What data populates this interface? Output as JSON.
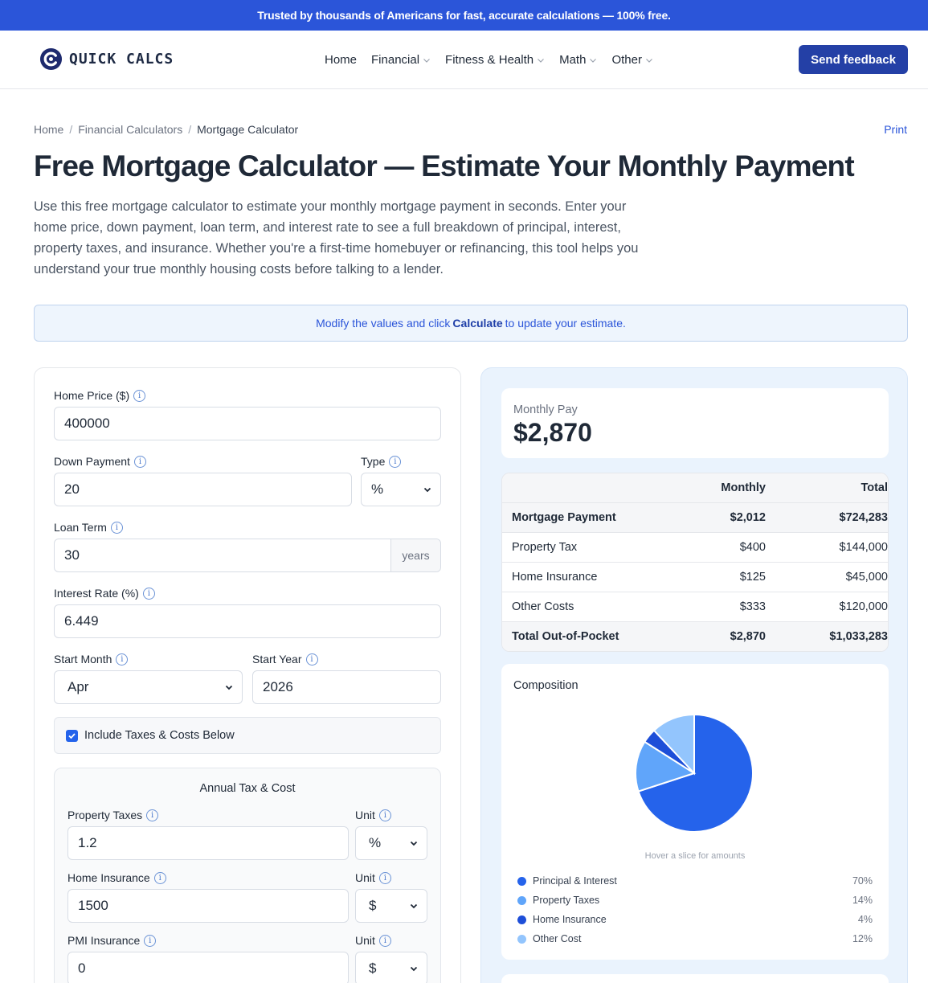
{
  "banner": "Trusted by thousands of Americans for fast, accurate calculations — 100% free.",
  "brand": {
    "name": "QUICK CALCS",
    "color": "#2b55d9"
  },
  "nav": {
    "items": [
      {
        "label": "Home",
        "dropdown": false
      },
      {
        "label": "Financial",
        "dropdown": true
      },
      {
        "label": "Fitness & Health",
        "dropdown": true
      },
      {
        "label": "Math",
        "dropdown": true
      },
      {
        "label": "Other",
        "dropdown": true
      }
    ],
    "feedback": "Send feedback"
  },
  "breadcrumb": [
    "Home",
    "Financial Calculators",
    "Mortgage Calculator"
  ],
  "print": "Print",
  "title": "Free Mortgage Calculator — Estimate Your Monthly Payment",
  "intro": "Use this free mortgage calculator to estimate your monthly mortgage payment in seconds. Enter your home price, down payment, loan term, and interest rate to see a full breakdown of principal, interest, property taxes, and insurance. Whether you're a first-time homebuyer or refinancing, this tool helps you understand your true monthly housing costs before talking to a lender.",
  "notice": {
    "before": "Modify the values and click",
    "bold": "Calculate",
    "after": "to update your estimate."
  },
  "form": {
    "home_price": {
      "label": "Home Price ($)",
      "value": "400000"
    },
    "down_payment": {
      "label": "Down Payment",
      "value": "20"
    },
    "type": {
      "label": "Type",
      "value": "%"
    },
    "loan_term": {
      "label": "Loan Term",
      "value": "30",
      "addon": "years"
    },
    "interest_rate": {
      "label": "Interest Rate (%)",
      "value": "6.449"
    },
    "start_month": {
      "label": "Start Month",
      "value": "Apr"
    },
    "start_year": {
      "label": "Start Year",
      "value": "2026"
    },
    "include_taxes": {
      "label": "Include Taxes & Costs Below",
      "checked": true
    },
    "annual": {
      "title": "Annual Tax & Cost",
      "property_taxes": {
        "label": "Property Taxes",
        "value": "1.2",
        "unit_label": "Unit",
        "unit": "%"
      },
      "home_insurance": {
        "label": "Home Insurance",
        "value": "1500",
        "unit_label": "Unit",
        "unit": "$"
      },
      "pmi_insurance": {
        "label": "PMI Insurance",
        "value": "0",
        "unit_label": "Unit",
        "unit": "$"
      }
    }
  },
  "results": {
    "monthly_label": "Monthly Pay",
    "monthly_value": "$2,870",
    "table": {
      "headers": [
        "",
        "Monthly",
        "Total"
      ],
      "rows": [
        [
          "Mortgage Payment",
          "$2,012",
          "$724,283"
        ],
        [
          "Property Tax",
          "$400",
          "$144,000"
        ],
        [
          "Home Insurance",
          "$125",
          "$45,000"
        ],
        [
          "Other Costs",
          "$333",
          "$120,000"
        ],
        [
          "Total Out-of-Pocket",
          "$2,870",
          "$1,033,283"
        ]
      ]
    },
    "composition": {
      "title": "Composition",
      "hint": "Hover a slice for amounts",
      "legend": [
        {
          "name": "Principal & Interest",
          "pct": "70%",
          "color": "#2563eb"
        },
        {
          "name": "Property Taxes",
          "pct": "14%",
          "color": "#60a5fa"
        },
        {
          "name": "Home Insurance",
          "pct": "4%",
          "color": "#1d4ed8"
        },
        {
          "name": "Other Cost",
          "pct": "12%",
          "color": "#93c5fd"
        }
      ]
    }
  },
  "chart_data": {
    "type": "pie",
    "categories": [
      "Principal & Interest",
      "Property Taxes",
      "Home Insurance",
      "Other Cost"
    ],
    "values": [
      70,
      14,
      4,
      12
    ],
    "colors": [
      "#2563eb",
      "#60a5fa",
      "#1d4ed8",
      "#93c5fd"
    ],
    "title": "Composition",
    "legend": "bottom"
  }
}
